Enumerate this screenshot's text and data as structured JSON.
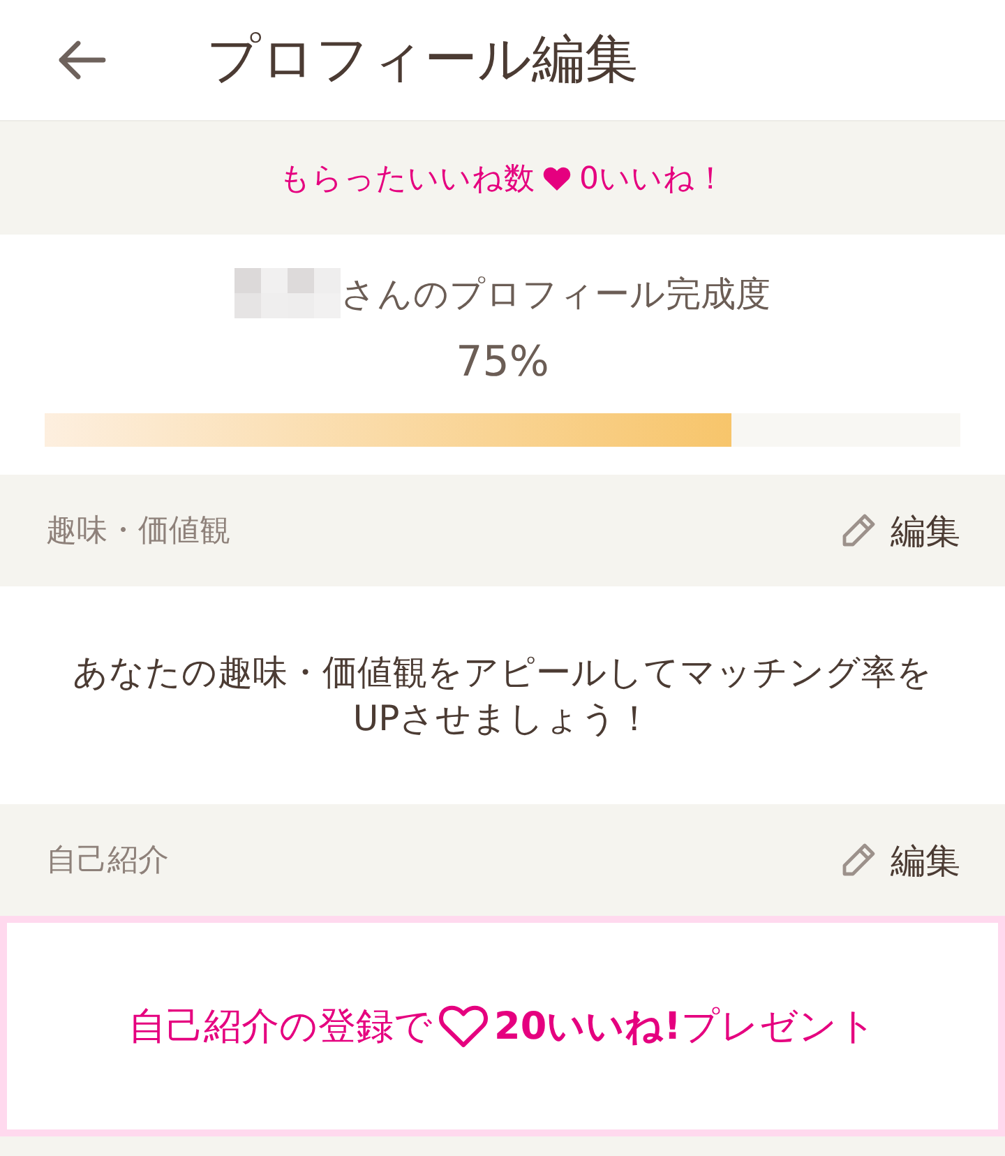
{
  "header": {
    "title": "プロフィール編集"
  },
  "likes_banner": {
    "label": "もらったいいね数",
    "count": "0いいね！"
  },
  "completion": {
    "label": "さんのプロフィール完成度",
    "percent": "75%",
    "level": 0.75
  },
  "sections": [
    {
      "kind": "message",
      "title": "趣味・価値観",
      "edit_label": "編集",
      "message": "あなたの趣味・価値観をアピールしてマッチング率をUPさせましょう！"
    },
    {
      "kind": "promo",
      "title": "自己紹介",
      "edit_label": "編集",
      "promo_prefix": "自己紹介の登録で",
      "promo_suffix": "**20いいね!**プレゼント"
    }
  ]
}
